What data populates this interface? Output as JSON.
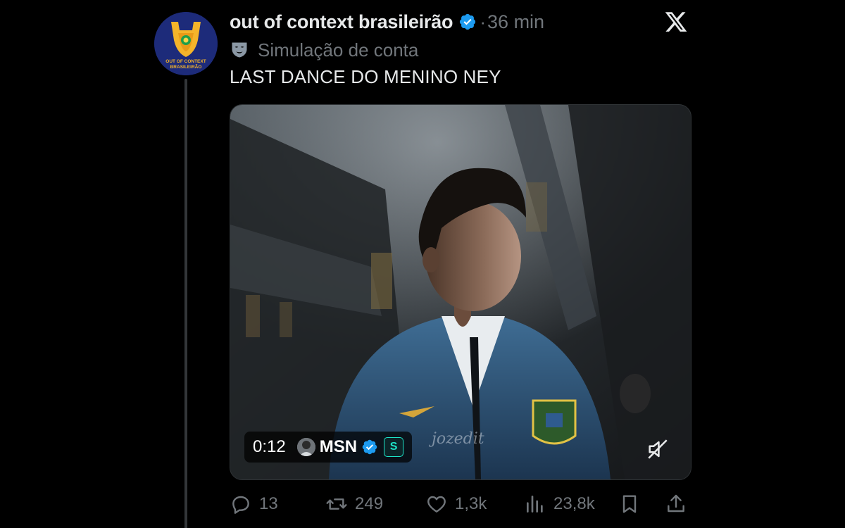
{
  "account": {
    "display_name": "out of context brasileirão",
    "time_separator": "·",
    "time_ago": "36 min",
    "verified": true,
    "avatar_text_line1": "OUT OF CONTEXT",
    "avatar_text_line2": "BRASILEIRÃO"
  },
  "label": {
    "text": "Simulação de conta",
    "icon": "theater-mask-icon"
  },
  "tweet": {
    "text": "LAST DANCE DO MENINO NEY"
  },
  "video": {
    "timestamp": "0:12",
    "source_name": "MSN",
    "source_verified": true,
    "source_badge": "S",
    "watermark": "jozedit",
    "muted": true
  },
  "actions": {
    "replies": "13",
    "reposts": "249",
    "likes": "1,3k",
    "views": "23,8k"
  },
  "colors": {
    "background": "#000000",
    "primary_text": "#e7e9ea",
    "secondary_text": "#71767b",
    "verified_blue": "#1d9bf0",
    "avatar_bg": "#1d2b7a"
  }
}
